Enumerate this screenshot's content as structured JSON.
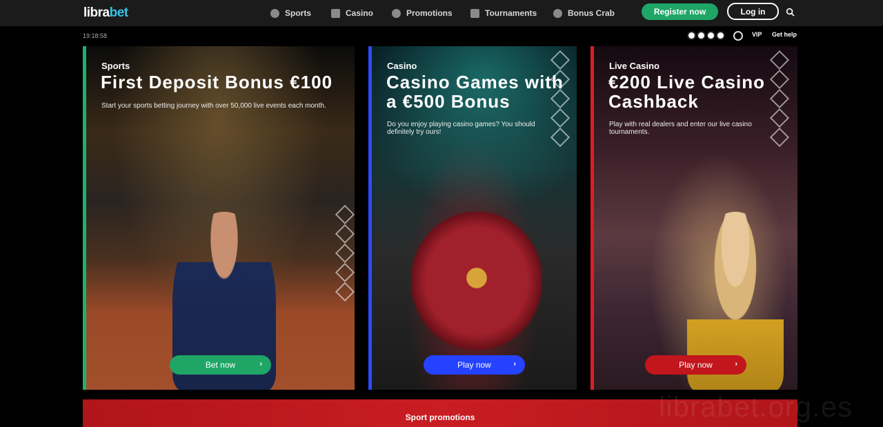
{
  "header": {
    "logo_text_a": "libra",
    "logo_text_b": "bet",
    "nav": [
      {
        "label": "Sports",
        "icon": "soccer-ball-icon"
      },
      {
        "label": "Casino",
        "icon": "dice-icon"
      },
      {
        "label": "Promotions",
        "icon": "gift-icon"
      },
      {
        "label": "Tournaments",
        "icon": "crown-icon"
      },
      {
        "label": "Bonus Crab",
        "icon": "crab-claw-icon"
      }
    ],
    "register_label": "Register now",
    "login_label": "Log in",
    "search_icon": "search-icon"
  },
  "subbar": {
    "time": "19:18:58",
    "vip_label": "VIP",
    "help_label": "Get help"
  },
  "cards": [
    {
      "category": "Sports",
      "title": "First Deposit Bonus €100",
      "description": "Start your sports betting journey with over 50,000 live events each month.",
      "cta": "Bet now",
      "accent": "#1db26b",
      "button_color": "#1fa667"
    },
    {
      "category": "Casino",
      "title": "Casino Games with a €500 Bonus",
      "description": "Do you enjoy playing casino games? You should definitely try ours!",
      "cta": "Play now",
      "accent": "#2e4bff",
      "button_color": "#2442ff"
    },
    {
      "category": "Live Casino",
      "title": "€200 Live Casino Cashback",
      "description": "Play with real dealers and enter our live casino tournaments.",
      "cta": "Play now",
      "accent": "#d81f26",
      "button_color": "#c2151c"
    }
  ],
  "promo": {
    "label": "Sport promotions"
  },
  "watermark": "librabet.org.es"
}
